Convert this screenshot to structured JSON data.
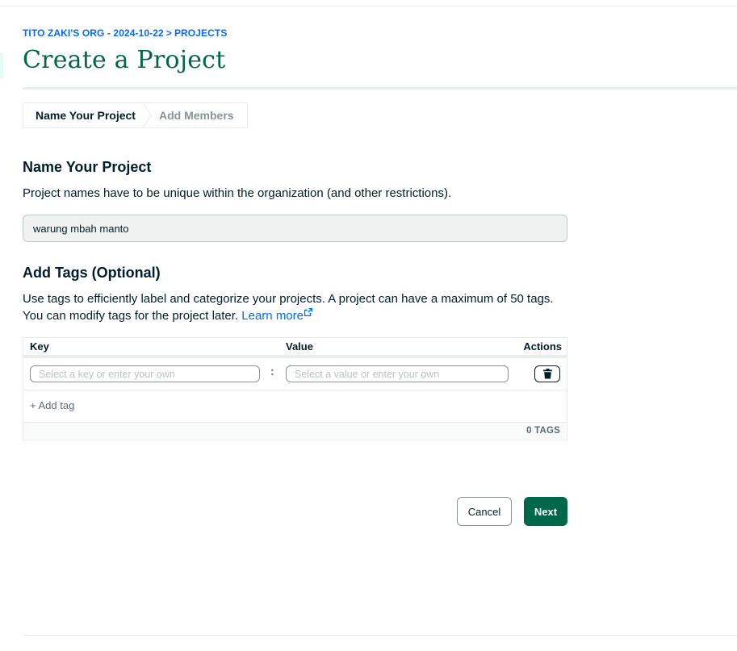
{
  "breadcrumb": {
    "org": "TITO ZAKI'S ORG - 2024-10-22",
    "separator": ">",
    "projects": "PROJECTS"
  },
  "page": {
    "title": "Create a Project"
  },
  "stepper": {
    "steps": [
      {
        "label": "Name Your Project",
        "active": true
      },
      {
        "label": "Add Members",
        "active": false
      }
    ]
  },
  "name_section": {
    "heading": "Name Your Project",
    "description": "Project names have to be unique within the organization (and other restrictions).",
    "input_value": "warung mbah manto"
  },
  "tags_section": {
    "heading": "Add Tags (Optional)",
    "description": "Use tags to efficiently label and categorize your projects. A project can have a maximum of 50 tags. You can modify tags for the project later.",
    "learn_more": "Learn more",
    "table": {
      "col_key": "Key",
      "col_value": "Value",
      "col_actions": "Actions",
      "key_placeholder": "Select a key or enter your own",
      "value_placeholder": "Select a value or enter your own",
      "separator": ":",
      "delete_icon": "trash-icon",
      "add_tag": "+ Add tag",
      "tag_count": "0 TAGS"
    }
  },
  "actions": {
    "cancel": "Cancel",
    "next": "Next"
  },
  "colors": {
    "brand_green": "#00684a",
    "link_blue": "#016bf8",
    "text_dark": "#001e2b",
    "muted": "#889397"
  }
}
